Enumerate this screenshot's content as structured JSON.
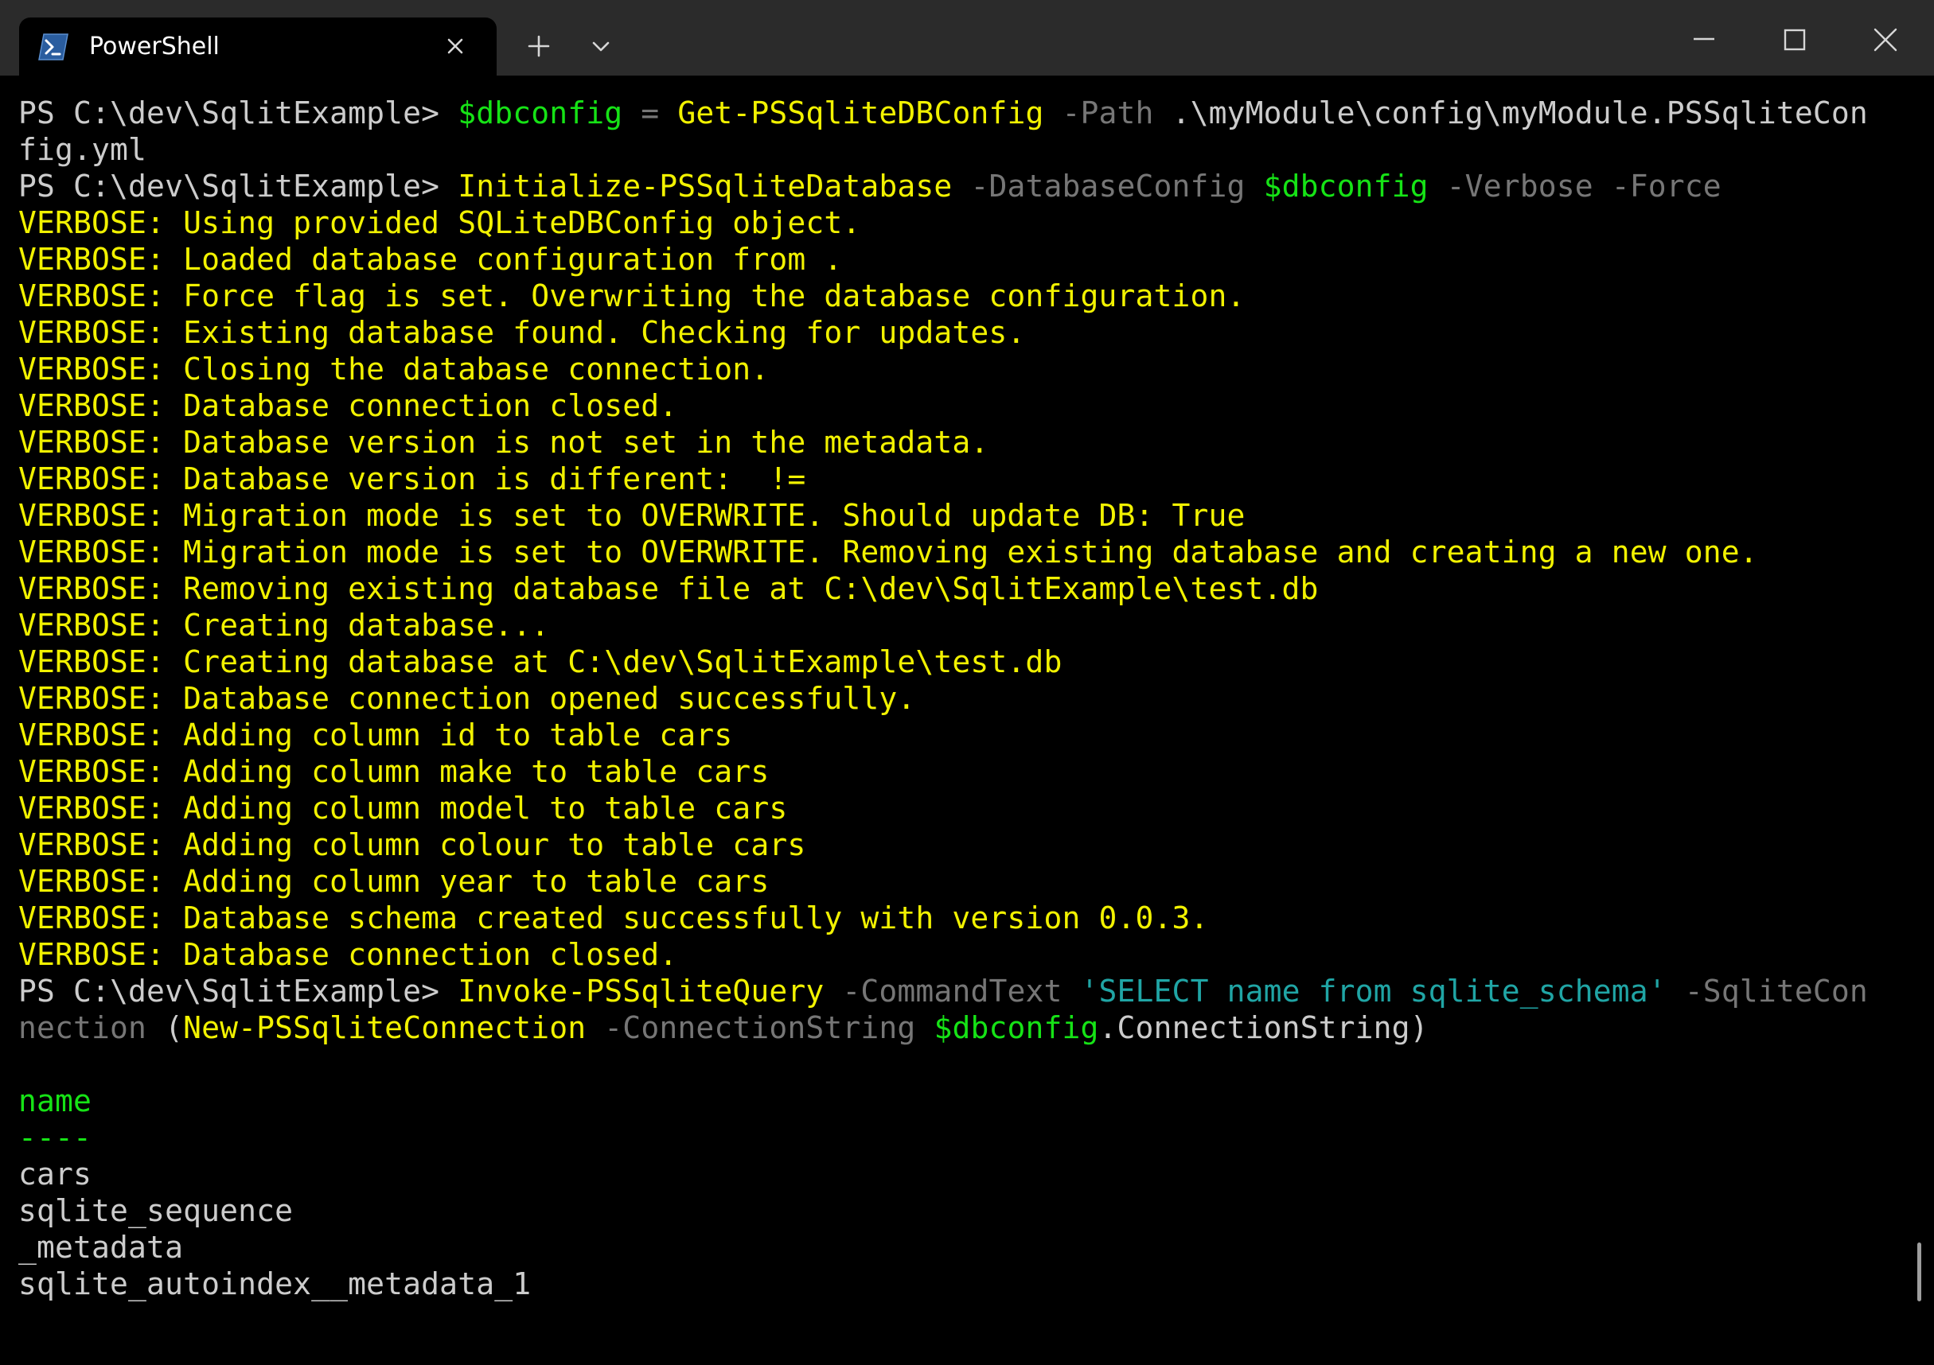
{
  "tab": {
    "title": "PowerShell",
    "icon": "powershell-icon",
    "close_icon": "close-icon"
  },
  "toolbar": {
    "new_tab_icon": "plus-icon",
    "dropdown_icon": "chevron-down-icon"
  },
  "window_controls": {
    "minimize_icon": "minimize-icon",
    "maximize_icon": "maximize-icon",
    "close_icon": "close-icon"
  },
  "palette": {
    "w": "#cccccc",
    "y": "#f9f1a5",
    "v": "#f2f200",
    "g": "#16e316",
    "d": "#767676",
    "c": "#3a96dd",
    "t": "#20a5a5",
    "s": "#3b78ff",
    "k": "#c8c8c8"
  },
  "terminal": {
    "lines": [
      {
        "segs": [
          [
            "PS C:\\dev\\SqlitExample> ",
            "w"
          ],
          [
            "$dbconfig",
            "g"
          ],
          [
            " ",
            "w"
          ],
          [
            "=",
            "d"
          ],
          [
            " ",
            "w"
          ],
          [
            "Get-PSSqliteDBConfig",
            "v"
          ],
          [
            " ",
            "w"
          ],
          [
            "-Path",
            "d"
          ],
          [
            " .\\myModule\\config\\myModule.PSSqliteCon",
            "w"
          ]
        ]
      },
      {
        "segs": [
          [
            "fig.yml",
            "w"
          ]
        ]
      },
      {
        "segs": [
          [
            "PS C:\\dev\\SqlitExample> ",
            "w"
          ],
          [
            "Initialize-PSSqliteDatabase",
            "v"
          ],
          [
            " ",
            "w"
          ],
          [
            "-DatabaseConfig",
            "d"
          ],
          [
            " ",
            "w"
          ],
          [
            "$dbconfig",
            "g"
          ],
          [
            " ",
            "w"
          ],
          [
            "-Verbose",
            "d"
          ],
          [
            " ",
            "w"
          ],
          [
            "-Force",
            "d"
          ]
        ]
      },
      {
        "segs": [
          [
            "VERBOSE: Using provided SQLiteDBConfig object.",
            "v"
          ]
        ]
      },
      {
        "segs": [
          [
            "VERBOSE: Loaded database configuration from .",
            "v"
          ]
        ]
      },
      {
        "segs": [
          [
            "VERBOSE: Force flag is set. Overwriting the database configuration.",
            "v"
          ]
        ]
      },
      {
        "segs": [
          [
            "VERBOSE: Existing database found. Checking for updates.",
            "v"
          ]
        ]
      },
      {
        "segs": [
          [
            "VERBOSE: Closing the database connection.",
            "v"
          ]
        ]
      },
      {
        "segs": [
          [
            "VERBOSE: Database connection closed.",
            "v"
          ]
        ]
      },
      {
        "segs": [
          [
            "VERBOSE: Database version is not set in the metadata.",
            "v"
          ]
        ]
      },
      {
        "segs": [
          [
            "VERBOSE: Database version is different:  !=",
            "v"
          ]
        ]
      },
      {
        "segs": [
          [
            "VERBOSE: Migration mode is set to OVERWRITE. Should update DB: True",
            "v"
          ]
        ]
      },
      {
        "segs": [
          [
            "VERBOSE: Migration mode is set to OVERWRITE. Removing existing database and creating a new one.",
            "v"
          ]
        ]
      },
      {
        "segs": [
          [
            "VERBOSE: Removing existing database file at C:\\dev\\SqlitExample\\test.db",
            "v"
          ]
        ]
      },
      {
        "segs": [
          [
            "VERBOSE: Creating database...",
            "v"
          ]
        ]
      },
      {
        "segs": [
          [
            "VERBOSE: Creating database at C:\\dev\\SqlitExample\\test.db",
            "v"
          ]
        ]
      },
      {
        "segs": [
          [
            "VERBOSE: Database connection opened successfully.",
            "v"
          ]
        ]
      },
      {
        "segs": [
          [
            "VERBOSE: Adding column id to table cars",
            "v"
          ]
        ]
      },
      {
        "segs": [
          [
            "VERBOSE: Adding column make to table cars",
            "v"
          ]
        ]
      },
      {
        "segs": [
          [
            "VERBOSE: Adding column model to table cars",
            "v"
          ]
        ]
      },
      {
        "segs": [
          [
            "VERBOSE: Adding column colour to table cars",
            "v"
          ]
        ]
      },
      {
        "segs": [
          [
            "VERBOSE: Adding column year to table cars",
            "v"
          ]
        ]
      },
      {
        "segs": [
          [
            "VERBOSE: Database schema created successfully with version 0.0.3.",
            "v"
          ]
        ]
      },
      {
        "segs": [
          [
            "VERBOSE: Database connection closed.",
            "v"
          ]
        ]
      },
      {
        "segs": [
          [
            "PS C:\\dev\\SqlitExample> ",
            "w"
          ],
          [
            "Invoke-PSSqliteQuery",
            "v"
          ],
          [
            " ",
            "w"
          ],
          [
            "-CommandText",
            "d"
          ],
          [
            " ",
            "w"
          ],
          [
            "'SELECT name from sqlite_schema'",
            "t"
          ],
          [
            " ",
            "w"
          ],
          [
            "-SqliteCon",
            "d"
          ]
        ]
      },
      {
        "segs": [
          [
            "nection",
            "d"
          ],
          [
            " (",
            "w"
          ],
          [
            "New-PSSqliteConnection",
            "v"
          ],
          [
            " ",
            "w"
          ],
          [
            "-ConnectionString",
            "d"
          ],
          [
            " ",
            "w"
          ],
          [
            "$dbconfig",
            "g"
          ],
          [
            ".ConnectionString)",
            "w"
          ]
        ]
      },
      {
        "segs": []
      },
      {
        "segs": [
          [
            "name",
            "g"
          ]
        ]
      },
      {
        "segs": [
          [
            "----",
            "g"
          ]
        ]
      },
      {
        "segs": [
          [
            "cars",
            "w"
          ]
        ]
      },
      {
        "segs": [
          [
            "sqlite_sequence",
            "w"
          ]
        ]
      },
      {
        "segs": [
          [
            "_metadata",
            "w"
          ]
        ]
      },
      {
        "segs": [
          [
            "sqlite_autoindex__metadata_1",
            "w"
          ]
        ]
      }
    ]
  }
}
